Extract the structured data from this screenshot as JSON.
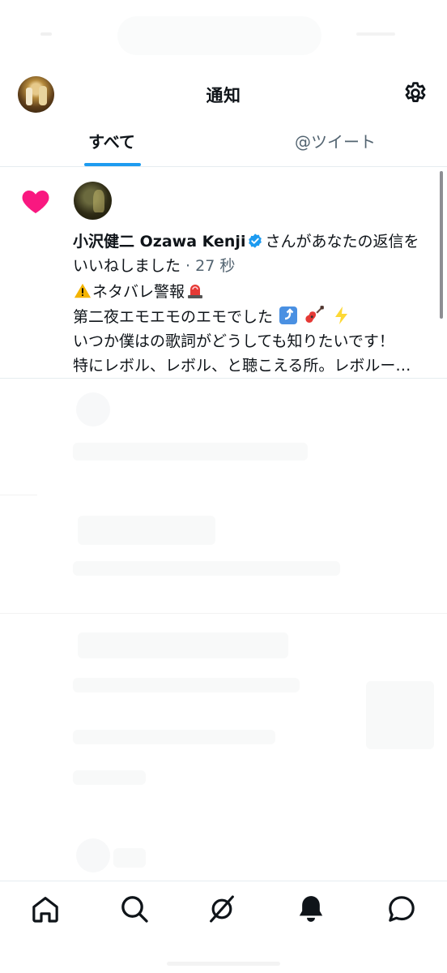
{
  "header": {
    "title": "通知"
  },
  "tabs": [
    {
      "label": "すべて",
      "active": true
    },
    {
      "label": "@ツイート",
      "active": false
    }
  ],
  "notification": {
    "user_name": "小沢健二 Ozawa Kenji",
    "action_text": "さんがあなたの返信を",
    "action_text_2": "いいねしました",
    "time": " · 27 秒",
    "tweet_line1": "ネタバレ警報",
    "tweet_line2": "第二夜エモエモのエモでした",
    "tweet_line3": "いつか僕はの歌詞がどうしても知りたいです！",
    "tweet_line4": "特にレボル、レボル、と聴こえる所。レボルー…",
    "icon": "heart-icon",
    "heart_color": "#f91880",
    "verified_color": "#1d9bf0"
  },
  "bottom_nav": {
    "items": [
      "home-icon",
      "search-icon",
      "spaces-icon",
      "notifications-icon",
      "messages-icon"
    ],
    "active": "notifications-icon"
  },
  "colors": {
    "accent": "#1d9bf0",
    "text": "#0f1419",
    "muted": "#536471"
  }
}
